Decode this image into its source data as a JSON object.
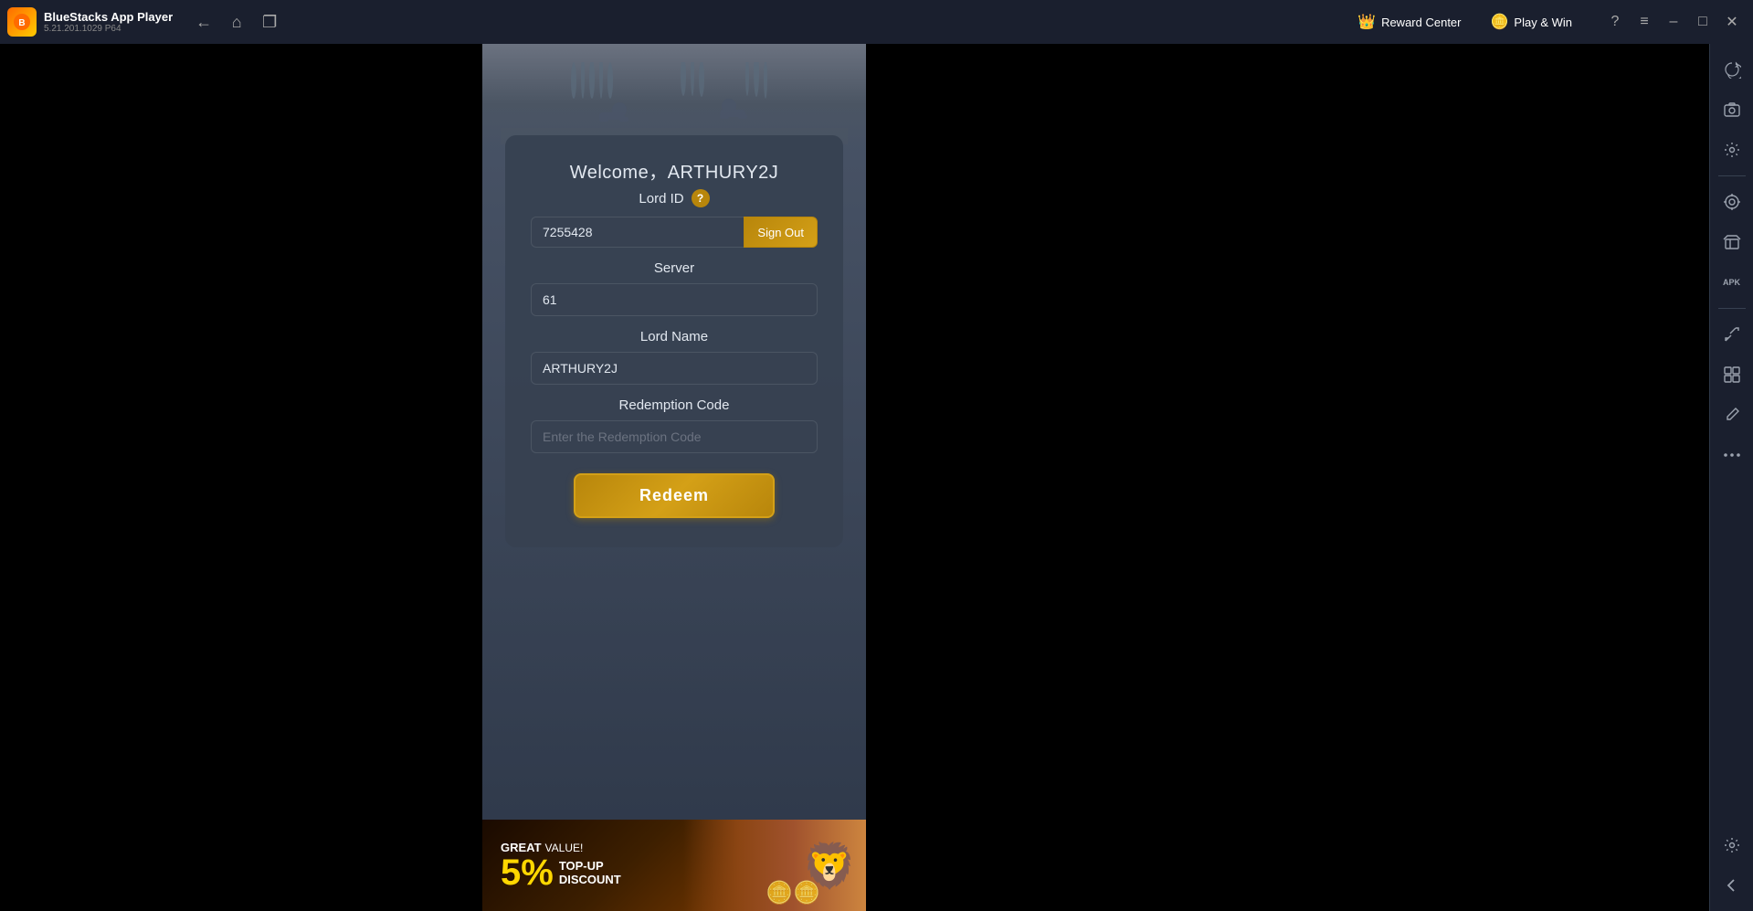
{
  "titlebar": {
    "app_name": "BlueStacks App Player",
    "app_version": "5.21.201.1029  P64",
    "nav": {
      "back_label": "←",
      "home_label": "⌂",
      "multi_label": "❐"
    },
    "reward_center": {
      "icon": "👑",
      "label": "Reward Center"
    },
    "play_win": {
      "icon": "🪙",
      "label": "Play & Win"
    },
    "actions": {
      "help": "?",
      "menu": "≡",
      "minimize": "–",
      "maximize": "□",
      "close": "✕"
    }
  },
  "game": {
    "welcome_text": "Welcome，ARTHURY2J",
    "lord_id_label": "Lord ID",
    "help_icon": "?",
    "lord_id_value": "7255428",
    "sign_out_label": "Sign Out",
    "server_label": "Server",
    "server_value": "61",
    "lord_name_label": "Lord Name",
    "lord_name_value": "ARTHURY2J",
    "redemption_code_label": "Redemption Code",
    "redemption_code_placeholder": "Enter the Redemption Code",
    "redeem_btn_label": "Redeem"
  },
  "banner": {
    "great_label": "GREAT",
    "value_label": "VALUE!",
    "percent": "5%",
    "topup_label": "TOP-UP",
    "discount_label": "DISCOUNT"
  },
  "sidebar": {
    "items": [
      {
        "icon": "⟳",
        "name": "rotate-icon"
      },
      {
        "icon": "📷",
        "name": "screenshot-icon"
      },
      {
        "icon": "⚙",
        "name": "settings-icon"
      },
      {
        "icon": "◉",
        "name": "target-icon"
      },
      {
        "icon": "📦",
        "name": "package-icon"
      },
      {
        "icon": "Apk",
        "name": "apk-icon"
      },
      {
        "icon": "⤢",
        "name": "resize-icon"
      },
      {
        "icon": "⊞",
        "name": "multi-icon"
      },
      {
        "icon": "✎",
        "name": "edit-icon"
      },
      {
        "icon": "•••",
        "name": "more-icon"
      },
      {
        "icon": "⚙",
        "name": "bottom-settings-icon"
      },
      {
        "icon": "←",
        "name": "back-icon"
      }
    ]
  }
}
